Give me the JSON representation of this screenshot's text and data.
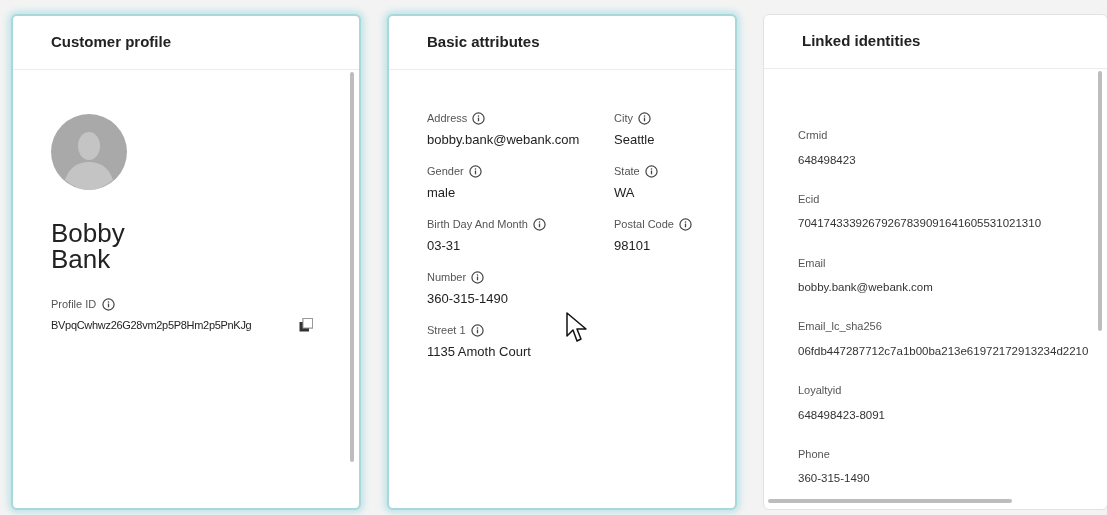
{
  "cards": [
    {
      "kind": "profile",
      "title": "Customer profile",
      "highlighted": true,
      "name_lines": [
        "Bobby",
        "Bank"
      ],
      "id_label": "Profile ID",
      "id_value": "BVpqCwhwz26G28vm2p5P8Hm2p5PnKJg"
    },
    {
      "kind": "attributes",
      "title": "Basic attributes",
      "highlighted": true,
      "rows": [
        [
          {
            "label": "Address",
            "value": "bobby.bank@webank.com"
          },
          {
            "label": "City",
            "value": "Seattle"
          }
        ],
        [
          {
            "label": "Gender",
            "value": "male"
          },
          {
            "label": "State",
            "value": "WA"
          }
        ],
        [
          {
            "label": "Birth Day And Month",
            "value": "03-31"
          },
          {
            "label": "Postal Code",
            "value": "98101"
          }
        ],
        [
          {
            "label": "Number",
            "value": "360-315-1490"
          }
        ],
        [
          {
            "label": "Street 1",
            "value": "1135 Amoth Court"
          }
        ]
      ]
    },
    {
      "kind": "identities",
      "title": "Linked identities",
      "highlighted": false,
      "fields": [
        {
          "label": "Crmid",
          "value": "648498423"
        },
        {
          "label": "Ecid",
          "value": "70417433392679267839091641605531021310"
        },
        {
          "label": "Email",
          "value": "bobby.bank@webank.com"
        },
        {
          "label": "Email_lc_sha256",
          "value": "06fdb447287712c7a1b00ba213e61972172913234d2210"
        },
        {
          "label": "Loyaltyid",
          "value": "648498423-8091"
        },
        {
          "label": "Phone",
          "value": "360-315-1490"
        }
      ]
    }
  ]
}
